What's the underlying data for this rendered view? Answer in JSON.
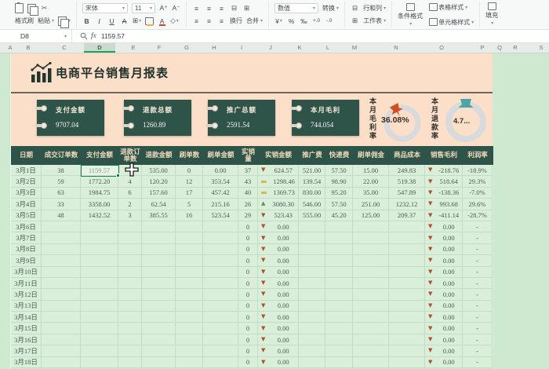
{
  "ribbon": {
    "format_painter": "格式刷",
    "paste": "粘贴",
    "font_name": "宋体",
    "font_size": "11",
    "bold": "B",
    "italic": "I",
    "underline": "U",
    "strikethrough": "A",
    "wrap": "换行",
    "merge": "合并",
    "number_format": "数值",
    "currency": "¥",
    "percent": "%",
    "permille": "‰",
    "convert": "转换",
    "rows_cols": "行和列",
    "worksheet": "工作表",
    "conditional_format": "条件格式",
    "table_style": "表格样式",
    "cell_style": "单元格样式",
    "fill": "填充"
  },
  "formula_bar": {
    "cell_ref": "D8",
    "fx_label": "fx",
    "value": "1159.57"
  },
  "column_strip": {
    "letters": [
      "A",
      "B",
      "C",
      "D",
      "E",
      "F",
      "G",
      "H",
      "I",
      "J",
      "K",
      "L",
      "M",
      "N",
      "O",
      "P",
      "Q",
      "R",
      "S"
    ],
    "selected": "D"
  },
  "report": {
    "title": "电商平台销售月报表",
    "cards": [
      {
        "label": "支付金额",
        "value": "9707.04"
      },
      {
        "label": "退款总额",
        "value": "1260.89"
      },
      {
        "label": "推广总额",
        "value": "2591.54"
      },
      {
        "label": "本月毛利",
        "value": "744.054"
      }
    ],
    "gauges": [
      {
        "label": "本月毛利率",
        "value": "36.08%",
        "pin_color": "#d14e24"
      },
      {
        "label": "本月退款率",
        "value": "4.7...",
        "pin_color": "#4fa3a5"
      }
    ]
  },
  "table": {
    "headers": [
      "日期",
      "成交订单数",
      "支付金额",
      "退款订单数",
      "退款金额",
      "刷单数",
      "刷单金额",
      "实销量",
      "实销金额",
      "推广费",
      "快递费",
      "刷单佣金",
      "商品成本",
      "销售毛利",
      "利润率"
    ],
    "rows": [
      [
        "3月1日",
        "38",
        "1159.57",
        "",
        "535.00",
        "0",
        "0.00",
        "37",
        {
          "t": "down",
          "v": "624.57"
        },
        "521.00",
        "57.50",
        "15.00",
        "249.83",
        {
          "t": "down",
          "v": "-218.76"
        },
        "-18.9%"
      ],
      [
        "3月2日",
        "59",
        "1772.20",
        "4",
        "120.20",
        "12",
        "353.54",
        "43",
        {
          "t": "flat",
          "v": "1298.46"
        },
        "139.54",
        "98.90",
        "22.00",
        "519.38",
        {
          "t": "down",
          "v": "518.64"
        },
        "29.3%"
      ],
      [
        "3月3日",
        "63",
        "1984.75",
        "6",
        "157.60",
        "17",
        "457.42",
        "40",
        {
          "t": "flat",
          "v": "1369.73"
        },
        "830.00",
        "95.20",
        "35.00",
        "547.89",
        {
          "t": "down",
          "v": "-138.36"
        },
        "-7.0%"
      ],
      [
        "3月4日",
        "33",
        "3358.00",
        "2",
        "62.54",
        "5",
        "215.16",
        "26",
        {
          "t": "up",
          "v": "3080.30"
        },
        "546.00",
        "57.50",
        "251.00",
        "1232.12",
        {
          "t": "down",
          "v": "993.68"
        },
        "29.6%"
      ],
      [
        "3月5日",
        "48",
        "1432.52",
        "3",
        "385.55",
        "16",
        "523.54",
        "29",
        {
          "t": "down",
          "v": "523.43"
        },
        "555.00",
        "45.20",
        "125.00",
        "209.37",
        {
          "t": "down",
          "v": "-411.14"
        },
        "-28.7%"
      ],
      [
        "3月6日",
        "",
        "",
        "",
        "",
        "",
        "",
        "0",
        {
          "t": "down",
          "v": "0.00"
        },
        "",
        "",
        "",
        "",
        {
          "t": "down",
          "v": "0.00"
        },
        "-"
      ],
      [
        "3月7日",
        "",
        "",
        "",
        "",
        "",
        "",
        "0",
        {
          "t": "down",
          "v": "0.00"
        },
        "",
        "",
        "",
        "",
        {
          "t": "down",
          "v": "0.00"
        },
        "-"
      ],
      [
        "3月8日",
        "",
        "",
        "",
        "",
        "",
        "",
        "0",
        {
          "t": "down",
          "v": "0.00"
        },
        "",
        "",
        "",
        "",
        {
          "t": "down",
          "v": "0.00"
        },
        "-"
      ],
      [
        "3月9日",
        "",
        "",
        "",
        "",
        "",
        "",
        "0",
        {
          "t": "down",
          "v": "0.00"
        },
        "",
        "",
        "",
        "",
        {
          "t": "down",
          "v": "0.00"
        },
        "-"
      ],
      [
        "3月10日",
        "",
        "",
        "",
        "",
        "",
        "",
        "0",
        {
          "t": "down",
          "v": "0.00"
        },
        "",
        "",
        "",
        "",
        {
          "t": "down",
          "v": "0.00"
        },
        "-"
      ],
      [
        "3月11日",
        "",
        "",
        "",
        "",
        "",
        "",
        "0",
        {
          "t": "down",
          "v": "0.00"
        },
        "",
        "",
        "",
        "",
        {
          "t": "down",
          "v": "0.00"
        },
        "-"
      ],
      [
        "3月12日",
        "",
        "",
        "",
        "",
        "",
        "",
        "0",
        {
          "t": "down",
          "v": "0.00"
        },
        "",
        "",
        "",
        "",
        {
          "t": "down",
          "v": "0.00"
        },
        "-"
      ],
      [
        "3月13日",
        "",
        "",
        "",
        "",
        "",
        "",
        "0",
        {
          "t": "down",
          "v": "0.00"
        },
        "",
        "",
        "",
        "",
        {
          "t": "down",
          "v": "0.00"
        },
        "-"
      ],
      [
        "3月14日",
        "",
        "",
        "",
        "",
        "",
        "",
        "0",
        {
          "t": "down",
          "v": "0.00"
        },
        "",
        "",
        "",
        "",
        {
          "t": "down",
          "v": "0.00"
        },
        "-"
      ],
      [
        "3月15日",
        "",
        "",
        "",
        "",
        "",
        "",
        "0",
        {
          "t": "down",
          "v": "0.00"
        },
        "",
        "",
        "",
        "",
        {
          "t": "down",
          "v": "0.00"
        },
        "-"
      ],
      [
        "3月16日",
        "",
        "",
        "",
        "",
        "",
        "",
        "0",
        {
          "t": "down",
          "v": "0.00"
        },
        "",
        "",
        "",
        "",
        {
          "t": "down",
          "v": "0.00"
        },
        "-"
      ],
      [
        "3月17日",
        "",
        "",
        "",
        "",
        "",
        "",
        "0",
        {
          "t": "down",
          "v": "0.00"
        },
        "",
        "",
        "",
        "",
        {
          "t": "down",
          "v": "0.00"
        },
        "-"
      ],
      [
        "3月18日",
        "",
        "",
        "",
        "",
        "",
        "",
        "0",
        {
          "t": "down",
          "v": "0.00"
        },
        "",
        "",
        "",
        "",
        {
          "t": "down",
          "v": "0.00"
        },
        "-"
      ]
    ]
  },
  "colors": {
    "header_bg": "#2e5348",
    "banner_bg": "#fbdfc9",
    "sheet_bg": "#cfe9d0",
    "row_bg": "#d9efda",
    "arrow_down": "#b0502c",
    "arrow_up": "#6d8a58",
    "arrow_flat": "#d9b84e",
    "selection": "#1b7a45"
  }
}
